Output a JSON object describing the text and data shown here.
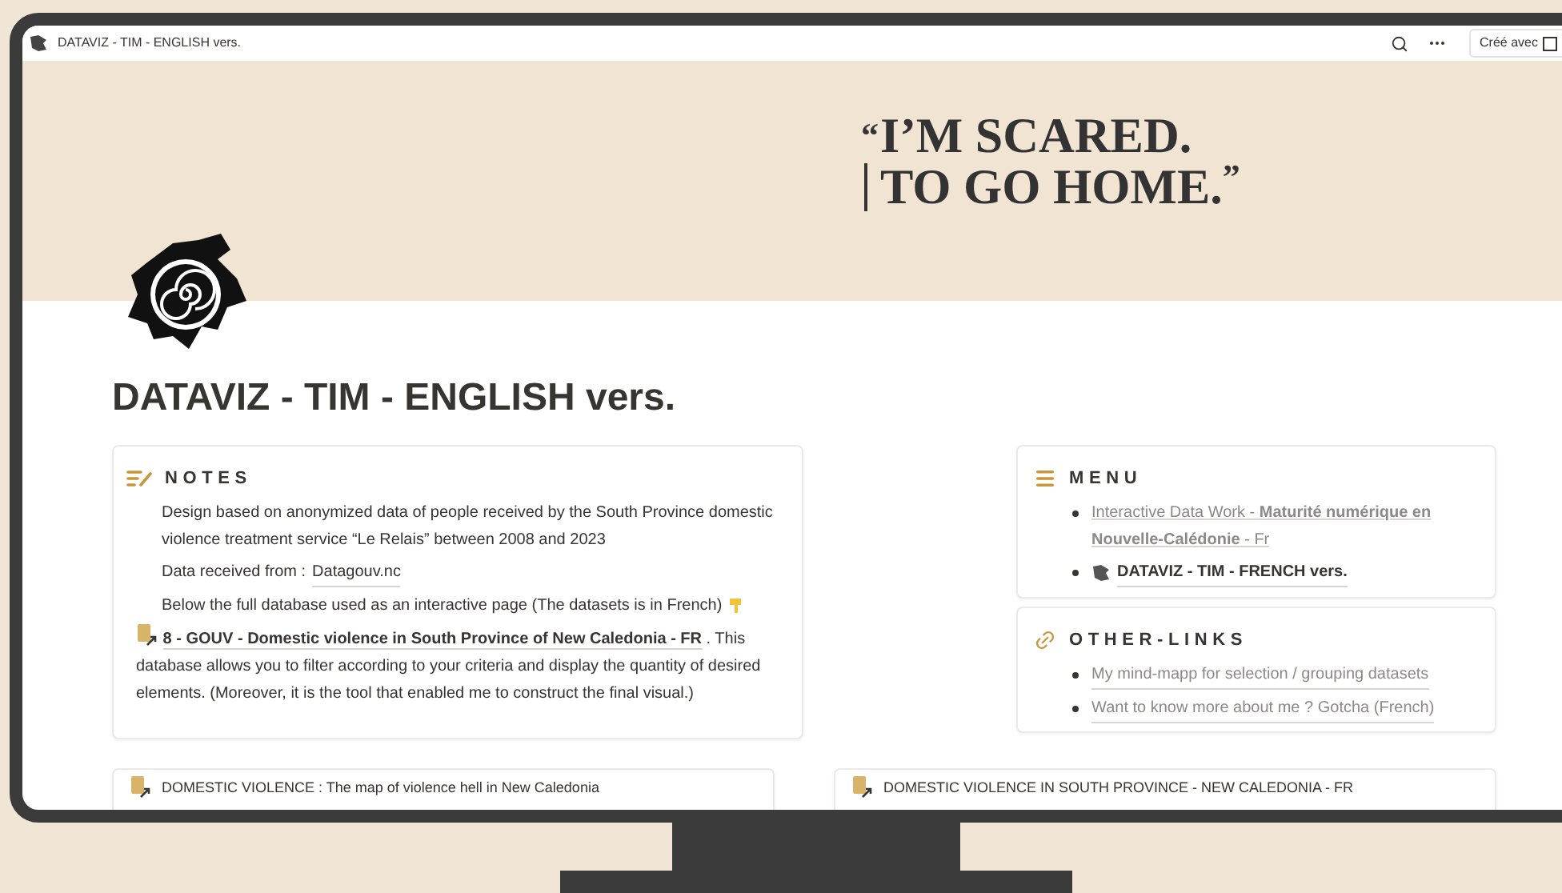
{
  "browser_bar": {
    "title": "DATAVIZ - TIM - ENGLISH vers.",
    "made_with": "Créé avec"
  },
  "cover": {
    "open_mark": "“",
    "line_1": "I’M SCARED.",
    "line_2": "TO GO HOME.",
    "close_mark": "”"
  },
  "page_title": "DATAVIZ - TIM - ENGLISH vers.",
  "notes": {
    "heading": "NOTES",
    "paragraphs": [
      {
        "kind": "text",
        "text": "Design based on anonymized data of people received by the South Province domestic violence treatment service “Le Relais” between 2008 and 2023"
      },
      {
        "kind": "source",
        "text": "Data received from :",
        "link": "Datagouv.nc"
      },
      {
        "kind": "pointer",
        "text": "Below the full database used as an interactive page (The datasets is in French)"
      },
      {
        "kind": "database",
        "link": "8 - GOUV -  Domestic violence in South Province of New Caledonia - FR",
        "text": ". This database allows you to filter according to your criteria and display the quantity of desired elements. (Moreover, it is the tool that enabled me to construct the final visual.)"
      }
    ]
  },
  "menu": {
    "heading": "MENU",
    "items": [
      {
        "kind": "link",
        "text": "Interactive Data Work - **Maturité numérique en Nouvelle-Calédonie** - Fr"
      },
      {
        "kind": "page",
        "text": "**DATAVIZ - TIM - FRENCH vers.**"
      }
    ]
  },
  "other_links": {
    "heading": "OTHER-LINKS",
    "items": [
      "My mind-mapp for selection / grouping datasets",
      "Want to know more about me ? Gotcha (French)"
    ]
  },
  "bottom_cards": [
    {
      "title": "DOMESTIC VIOLENCE : The map of violence hell in New Caledonia"
    },
    {
      "title": "DOMESTIC VIOLENCE IN SOUTH PROVINCE - NEW CALEDONIA - FR"
    }
  ]
}
